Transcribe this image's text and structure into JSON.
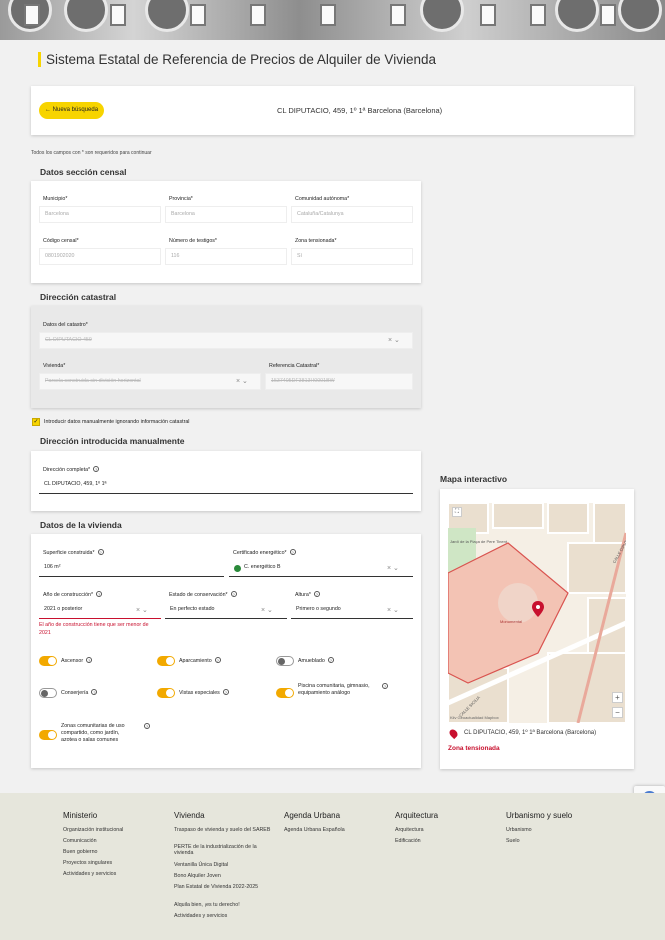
{
  "app_title": "Sistema Estatal de Referencia de Precios de Alquiler de Vivienda",
  "search": {
    "button": "Nueva búsqueda",
    "address": "CL DIPUTACIO, 459, 1º 1ª Barcelona (Barcelona)"
  },
  "required_note": "Todos los campos con * son requeridos para continuar",
  "censal": {
    "title": "Datos sección censal",
    "municipio": {
      "label": "Municipio*",
      "value": "Barcelona"
    },
    "provincia": {
      "label": "Provincia*",
      "value": "Barcelona"
    },
    "comunidad": {
      "label": "Comunidad autónoma*",
      "value": "Cataluña/Catalunya"
    },
    "codigo": {
      "label": "Código censal*",
      "value": "0801902020"
    },
    "testigos": {
      "label": "Número de testigos*",
      "value": "116"
    },
    "zona": {
      "label": "Zona tensionada*",
      "value": "Sí"
    }
  },
  "catastral": {
    "title": "Dirección catastral",
    "datos": {
      "label": "Datos del catastro*",
      "value": "CL DIPUTACIO 459"
    },
    "vivienda": {
      "label": "Vivienda*",
      "value": "Parcela construida sin división horizontal"
    },
    "referencia": {
      "label": "Referencia Catastral*",
      "value": "1537405DF3813H0001BW"
    }
  },
  "manual_checkbox": "Introducir datos manualmente ignorando información catastral",
  "manual": {
    "title": "Dirección introducida manualmente",
    "label": "Dirección completa*",
    "value": "CL DIPUTACIO, 459, 1º 1ª"
  },
  "vivienda": {
    "title": "Datos de la vivienda",
    "superficie": {
      "label": "Superficie construida*",
      "value": "106  m²"
    },
    "certificado": {
      "label": "Certificado energético*",
      "value": "C. energético B"
    },
    "anio": {
      "label": "Año de construcción*",
      "value": "2021 o posterior",
      "error": "El año de construcción tiene que ser menor de 2021"
    },
    "estado": {
      "label": "Estado de conservación*",
      "value": "En perfecto estado"
    },
    "altura": {
      "label": "Altura*",
      "value": "Primero o segundo"
    },
    "toggles": {
      "ascensor": {
        "label": "Ascensor",
        "on": true
      },
      "aparcamiento": {
        "label": "Aparcamiento",
        "on": true
      },
      "amueblado": {
        "label": "Amueblado",
        "on": false
      },
      "conserjeria": {
        "label": "Conserjería",
        "on": false
      },
      "vistas": {
        "label": "Vistas especiales",
        "on": true
      },
      "piscina": {
        "label": "Piscina comunitaria, gimnasio, equipamiento análogo",
        "on": true
      },
      "zonas": {
        "label": "Zonas comunitarias de uso compartido, como jardín, azotea o salas comunes",
        "on": true
      }
    }
  },
  "map": {
    "title": "Mapa interactivo",
    "address": "CL DIPUTACIO, 459, 1º 1ª Barcelona (Barcelona)",
    "zona": "Zona tensionada",
    "attribution": "Kiiv Geoactualidad Mapbox",
    "labels": {
      "street1": "CALLE DIPUTACIÓ",
      "street2": "CALLE SICILIA",
      "place": "Monumental",
      "plaza": "Jardí de la Plaça de Pere Tinent"
    },
    "accent": "#c8102e"
  },
  "footer": {
    "columns": [
      {
        "title": "Ministerio",
        "links": [
          "Organización institucional",
          "Comunicación",
          "Buen gobierno",
          "Proyectos singulares",
          "Actividades y servicios"
        ]
      },
      {
        "title": "Vivienda",
        "links": [
          "Traspaso de vivienda y suelo del SAREB",
          "PERTE de la industrialización de la vivienda",
          "Ventanilla Única Digital",
          "Bono Alquiler Joven",
          "Plan Estatal de Vivienda 2022-2025",
          "Alquila bien, ¡es tu derecho!",
          "Actividades y servicios"
        ]
      },
      {
        "title": "Agenda Urbana",
        "links": [
          "Agenda Urbana Española"
        ]
      },
      {
        "title": "Arquitectura",
        "links": [
          "Arquitectura",
          "Edificación"
        ]
      },
      {
        "title": "Urbanismo y suelo",
        "links": [
          "Urbanismo",
          "Suelo"
        ]
      }
    ]
  }
}
